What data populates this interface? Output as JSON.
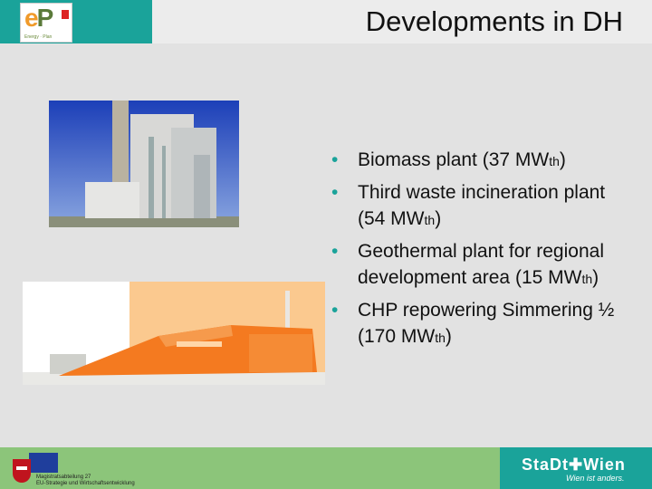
{
  "title": "Developments in DH",
  "logo": {
    "letters": "e",
    "m_letter": "P",
    "tagline": "Energy · Plan"
  },
  "bullets": [
    {
      "text": "Biomass plant (37 MW",
      "sub": "th",
      "suffix": ")"
    },
    {
      "text": "Third waste incineration plant (54 MW",
      "sub": "th",
      "suffix": ")"
    },
    {
      "text": "Geothermal plant for regional development area (15 MW",
      "sub": "th",
      "suffix": ")"
    },
    {
      "text": "CHP repowering Simmering ½ (170 MW",
      "sub": "th",
      "suffix": ")"
    }
  ],
  "footer": {
    "org_line1": "Magistratsabteilung 27",
    "org_line2": "EU-Strategie und Wirtschaftsentwicklung",
    "city_logo": "StaDt✚Wien",
    "city_tagline": "Wien ist anders."
  },
  "colors": {
    "teal": "#1aa39a",
    "green": "#8cc57a",
    "orange": "#f47a20"
  }
}
